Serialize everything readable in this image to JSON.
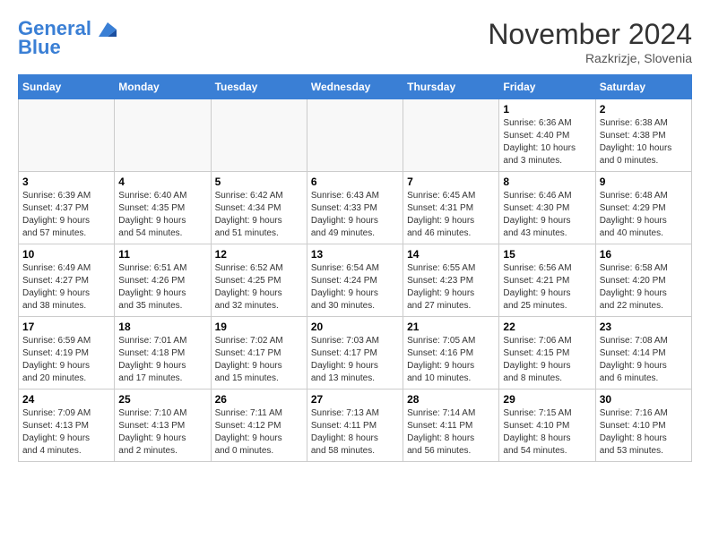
{
  "header": {
    "logo_line1": "General",
    "logo_line2": "Blue",
    "month_title": "November 2024",
    "subtitle": "Razkrizje, Slovenia"
  },
  "days_of_week": [
    "Sunday",
    "Monday",
    "Tuesday",
    "Wednesday",
    "Thursday",
    "Friday",
    "Saturday"
  ],
  "weeks": [
    [
      {
        "day": "",
        "info": ""
      },
      {
        "day": "",
        "info": ""
      },
      {
        "day": "",
        "info": ""
      },
      {
        "day": "",
        "info": ""
      },
      {
        "day": "",
        "info": ""
      },
      {
        "day": "1",
        "info": "Sunrise: 6:36 AM\nSunset: 4:40 PM\nDaylight: 10 hours\nand 3 minutes."
      },
      {
        "day": "2",
        "info": "Sunrise: 6:38 AM\nSunset: 4:38 PM\nDaylight: 10 hours\nand 0 minutes."
      }
    ],
    [
      {
        "day": "3",
        "info": "Sunrise: 6:39 AM\nSunset: 4:37 PM\nDaylight: 9 hours\nand 57 minutes."
      },
      {
        "day": "4",
        "info": "Sunrise: 6:40 AM\nSunset: 4:35 PM\nDaylight: 9 hours\nand 54 minutes."
      },
      {
        "day": "5",
        "info": "Sunrise: 6:42 AM\nSunset: 4:34 PM\nDaylight: 9 hours\nand 51 minutes."
      },
      {
        "day": "6",
        "info": "Sunrise: 6:43 AM\nSunset: 4:33 PM\nDaylight: 9 hours\nand 49 minutes."
      },
      {
        "day": "7",
        "info": "Sunrise: 6:45 AM\nSunset: 4:31 PM\nDaylight: 9 hours\nand 46 minutes."
      },
      {
        "day": "8",
        "info": "Sunrise: 6:46 AM\nSunset: 4:30 PM\nDaylight: 9 hours\nand 43 minutes."
      },
      {
        "day": "9",
        "info": "Sunrise: 6:48 AM\nSunset: 4:29 PM\nDaylight: 9 hours\nand 40 minutes."
      }
    ],
    [
      {
        "day": "10",
        "info": "Sunrise: 6:49 AM\nSunset: 4:27 PM\nDaylight: 9 hours\nand 38 minutes."
      },
      {
        "day": "11",
        "info": "Sunrise: 6:51 AM\nSunset: 4:26 PM\nDaylight: 9 hours\nand 35 minutes."
      },
      {
        "day": "12",
        "info": "Sunrise: 6:52 AM\nSunset: 4:25 PM\nDaylight: 9 hours\nand 32 minutes."
      },
      {
        "day": "13",
        "info": "Sunrise: 6:54 AM\nSunset: 4:24 PM\nDaylight: 9 hours\nand 30 minutes."
      },
      {
        "day": "14",
        "info": "Sunrise: 6:55 AM\nSunset: 4:23 PM\nDaylight: 9 hours\nand 27 minutes."
      },
      {
        "day": "15",
        "info": "Sunrise: 6:56 AM\nSunset: 4:21 PM\nDaylight: 9 hours\nand 25 minutes."
      },
      {
        "day": "16",
        "info": "Sunrise: 6:58 AM\nSunset: 4:20 PM\nDaylight: 9 hours\nand 22 minutes."
      }
    ],
    [
      {
        "day": "17",
        "info": "Sunrise: 6:59 AM\nSunset: 4:19 PM\nDaylight: 9 hours\nand 20 minutes."
      },
      {
        "day": "18",
        "info": "Sunrise: 7:01 AM\nSunset: 4:18 PM\nDaylight: 9 hours\nand 17 minutes."
      },
      {
        "day": "19",
        "info": "Sunrise: 7:02 AM\nSunset: 4:17 PM\nDaylight: 9 hours\nand 15 minutes."
      },
      {
        "day": "20",
        "info": "Sunrise: 7:03 AM\nSunset: 4:17 PM\nDaylight: 9 hours\nand 13 minutes."
      },
      {
        "day": "21",
        "info": "Sunrise: 7:05 AM\nSunset: 4:16 PM\nDaylight: 9 hours\nand 10 minutes."
      },
      {
        "day": "22",
        "info": "Sunrise: 7:06 AM\nSunset: 4:15 PM\nDaylight: 9 hours\nand 8 minutes."
      },
      {
        "day": "23",
        "info": "Sunrise: 7:08 AM\nSunset: 4:14 PM\nDaylight: 9 hours\nand 6 minutes."
      }
    ],
    [
      {
        "day": "24",
        "info": "Sunrise: 7:09 AM\nSunset: 4:13 PM\nDaylight: 9 hours\nand 4 minutes."
      },
      {
        "day": "25",
        "info": "Sunrise: 7:10 AM\nSunset: 4:13 PM\nDaylight: 9 hours\nand 2 minutes."
      },
      {
        "day": "26",
        "info": "Sunrise: 7:11 AM\nSunset: 4:12 PM\nDaylight: 9 hours\nand 0 minutes."
      },
      {
        "day": "27",
        "info": "Sunrise: 7:13 AM\nSunset: 4:11 PM\nDaylight: 8 hours\nand 58 minutes."
      },
      {
        "day": "28",
        "info": "Sunrise: 7:14 AM\nSunset: 4:11 PM\nDaylight: 8 hours\nand 56 minutes."
      },
      {
        "day": "29",
        "info": "Sunrise: 7:15 AM\nSunset: 4:10 PM\nDaylight: 8 hours\nand 54 minutes."
      },
      {
        "day": "30",
        "info": "Sunrise: 7:16 AM\nSunset: 4:10 PM\nDaylight: 8 hours\nand 53 minutes."
      }
    ]
  ]
}
